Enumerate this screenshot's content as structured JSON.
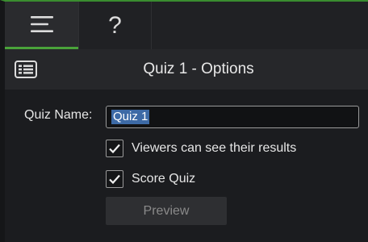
{
  "tabs": {
    "properties_icon": "menu-lines-icon",
    "help_label": "?"
  },
  "header": {
    "title": "Quiz 1 - Options",
    "icon": "list-card-icon"
  },
  "form": {
    "quiz_name_label": "Quiz Name:",
    "quiz_name_value": "Quiz 1",
    "viewers_checkbox": {
      "label": "Viewers can see their results",
      "checked": true
    },
    "score_checkbox": {
      "label": "Score Quiz",
      "checked": true
    },
    "preview_label": "Preview"
  },
  "colors": {
    "accent": "#4aa33a",
    "background": "#1b1c1f",
    "selection": "#3d6aa6"
  }
}
